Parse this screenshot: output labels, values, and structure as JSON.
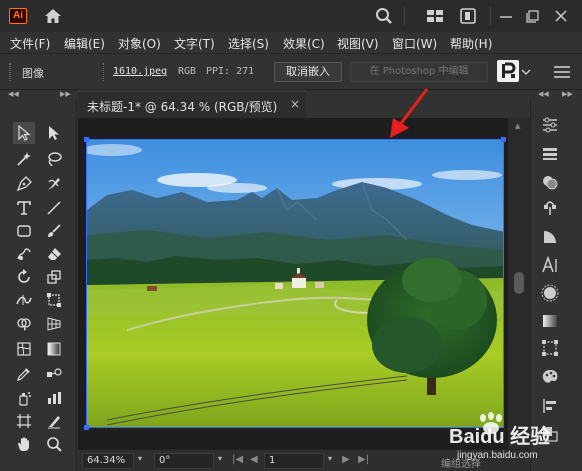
{
  "app": {
    "logo": "Ai"
  },
  "titlebar_icons": [
    "home-icon",
    "search-icon",
    "arrange-documents-icon",
    "search-adobe-stock-icon",
    "minimize-icon",
    "restore-icon",
    "close-icon"
  ],
  "menu": [
    "文件(F)",
    "编辑(E)",
    "对象(O)",
    "文字(T)",
    "选择(S)",
    "效果(C)",
    "视图(V)",
    "窗口(W)",
    "帮助(H)"
  ],
  "control_bar": {
    "object_type": "图像",
    "file_name": "1610.jpeg",
    "color_mode": "RGB",
    "ppi": "PPI: 271",
    "unembed_button": "取消嵌入",
    "edit_in_photoshop": "在 Photoshop 中编辑"
  },
  "document_tab": {
    "title": "未标题-1* @ 64.34 % (RGB/预览)",
    "close": "×"
  },
  "status_bar": {
    "zoom": "64.34%",
    "rotation": "0°",
    "artboard": "1",
    "status": "编组选择"
  },
  "watermark": {
    "brand": "Baidu 经验",
    "url": "jingyan.baidu.com"
  },
  "colors": {
    "accent_orange": "#ff7c00",
    "selection_blue": "#3a6cff",
    "annotation_red": "#e82020"
  }
}
